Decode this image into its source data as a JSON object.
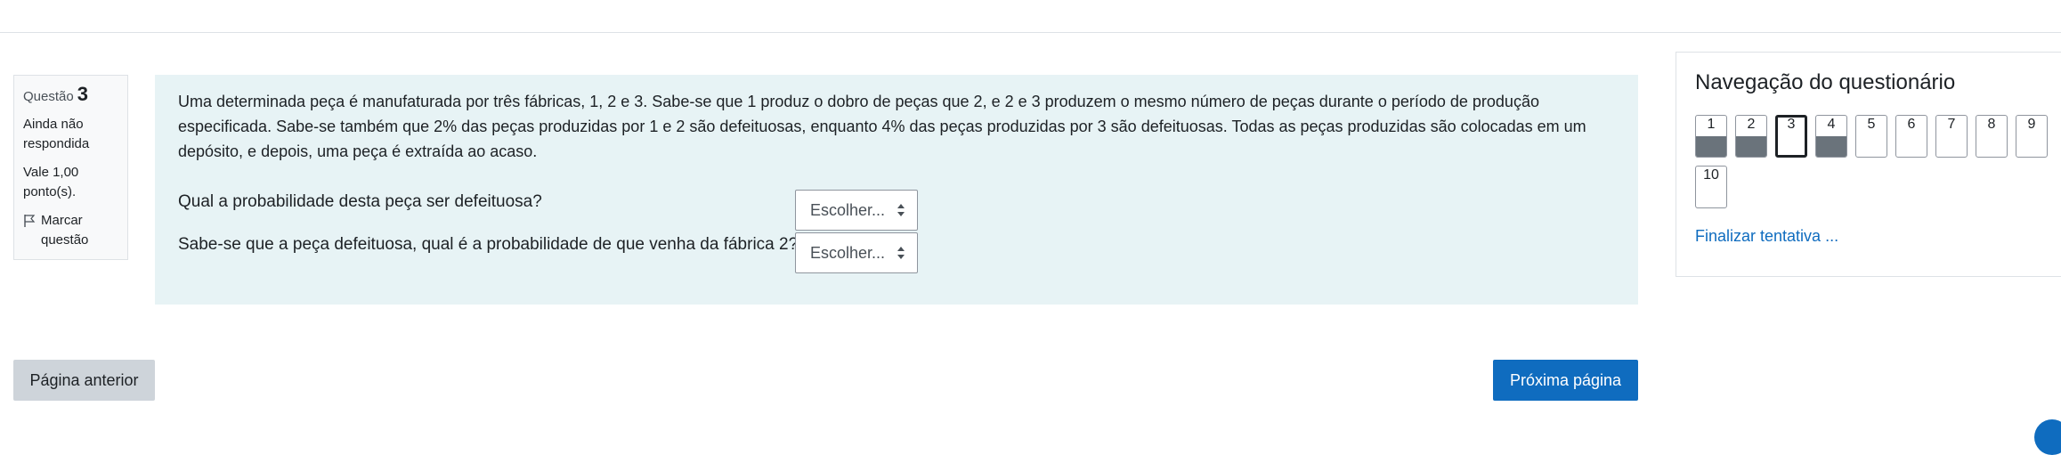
{
  "info": {
    "question_label": "Questão",
    "question_number": "3",
    "state": "Ainda não respondida",
    "grade": "Vale 1,00 ponto(s).",
    "flag_label": "Marcar questão",
    "flag_icon": "flag-icon"
  },
  "question": {
    "text": "Uma determinada peça é manufaturada por três fábricas, 1, 2 e 3. Sabe-se que 1 produz o dobro de peças que 2, e 2 e 3 produzem o mesmo número de peças durante o período de produção especificada. Sabe-se também que 2% das peças produzidas por 1 e 2 são defeituosas, enquanto 4% das peças produzidas por 3 são defeituosas. Todas as peças produzidas são colocadas em um depósito, e depois, uma peça é extraída ao acaso.",
    "sub1": "Qual a probabilidade desta peça ser defeituosa?",
    "sub2": "Sabe-se que a peça defeituosa, qual é a probabilidade de que venha da fábrica 2?",
    "select1_value": "Escolher...",
    "select2_value": "Escolher..."
  },
  "buttons": {
    "prev": "Página anterior",
    "next": "Próxima página"
  },
  "nav": {
    "title": "Navegação do questionário",
    "questions": [
      {
        "n": "1",
        "state": "answered"
      },
      {
        "n": "2",
        "state": "answered"
      },
      {
        "n": "3",
        "state": "current"
      },
      {
        "n": "4",
        "state": "answered"
      },
      {
        "n": "5",
        "state": "empty"
      },
      {
        "n": "6",
        "state": "empty"
      },
      {
        "n": "7",
        "state": "empty"
      },
      {
        "n": "8",
        "state": "empty"
      },
      {
        "n": "9",
        "state": "empty"
      },
      {
        "n": "10",
        "state": "empty"
      }
    ],
    "finish": "Finalizar tentativa ..."
  },
  "colors": {
    "accent": "#0f6cbf",
    "question_bg": "#e7f3f5",
    "answered_fill": "#6a737b"
  }
}
